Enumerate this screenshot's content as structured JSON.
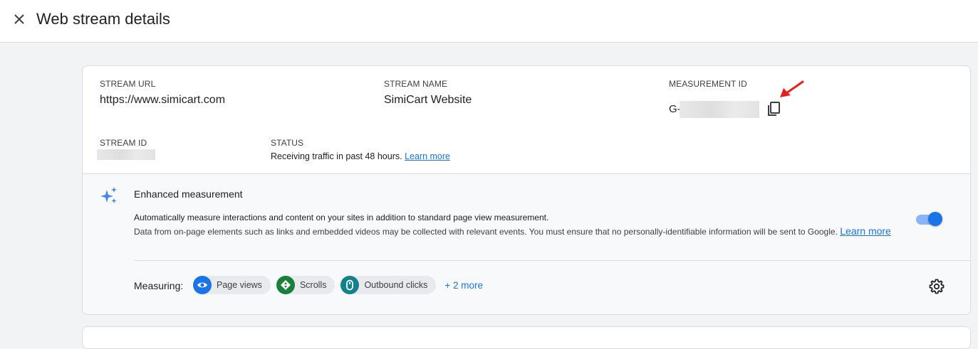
{
  "header": {
    "title": "Web stream details",
    "close_icon": "close-icon"
  },
  "stream": {
    "url_label": "STREAM URL",
    "url_value": "https://www.simicart.com",
    "name_label": "STREAM NAME",
    "name_value": "SimiCart Website",
    "measurement_label": "MEASUREMENT ID",
    "measurement_prefix": "G-",
    "copy_icon": "copy-icon",
    "id_label": "STREAM ID",
    "status_label": "STATUS",
    "status_text": "Receiving traffic in past 48 hours.",
    "status_link": "Learn more"
  },
  "enhanced": {
    "icon": "sparkle-icon",
    "title": "Enhanced measurement",
    "desc_line1": "Automatically measure interactions and content on your sites in addition to standard page view measurement.",
    "desc_line2": "Data from on-page elements such as links and embedded videos may be collected with relevant events. You must ensure that no personally-identifiable information will be sent to Google.",
    "learn_more": "Learn more",
    "toggle_on": true,
    "measuring_label": "Measuring:",
    "chips": [
      {
        "label": "Page views",
        "icon": "eye-icon",
        "color": "#1a73e8"
      },
      {
        "label": "Scrolls",
        "icon": "compass-icon",
        "color": "#188038"
      },
      {
        "label": "Outbound clicks",
        "icon": "mouse-icon",
        "color": "#12828c"
      }
    ],
    "more_label": "+ 2 more",
    "settings_icon": "gear-icon"
  },
  "colors": {
    "accent": "#1a73e8",
    "annotation_arrow": "#e8201a"
  }
}
